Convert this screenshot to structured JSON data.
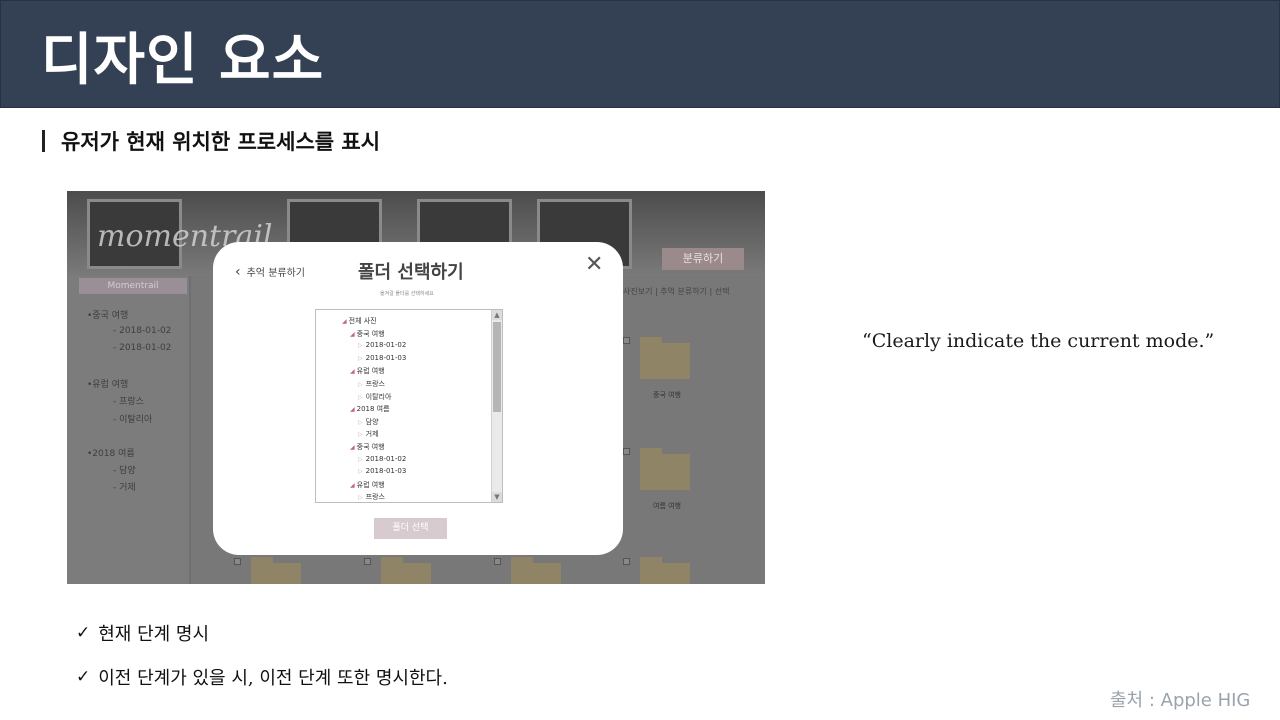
{
  "title": "디자인 요소",
  "subtitle": "유저가 현재 위치한 프로세스를 표시",
  "screenshot": {
    "logo": "momentrail",
    "sort_button": "분류하기",
    "path_text": "사진보기 | 추억 분류하기 | 선택",
    "sidebar_tab": "Momentrail",
    "sidebar_items": [
      "•중국 여행",
      "- 2018-01-02",
      "- 2018-01-02",
      "•유럽 여행",
      "- 프랑스",
      "- 이탈리아",
      "•2018 여름",
      "- 담양",
      "- 거제"
    ],
    "folder_labels": [
      "중국 여행",
      "여름 여행"
    ],
    "modal": {
      "back_label": "추억 분류하기",
      "title": "폴더 선택하기",
      "subtitle": "옮겨갈 폴더를 선택하세요",
      "close_symbol": "✕",
      "tree": [
        {
          "label": "전체 사진",
          "type": "caret"
        },
        {
          "label": "중국 여행",
          "type": "caret"
        },
        {
          "label": "2018-01-02",
          "type": "leaf"
        },
        {
          "label": "2018-01-03",
          "type": "leaf"
        },
        {
          "label": "유럽 여행",
          "type": "caret"
        },
        {
          "label": "프랑스",
          "type": "leaf"
        },
        {
          "label": "이탈리아",
          "type": "leaf"
        },
        {
          "label": "2018 여름",
          "type": "caret"
        },
        {
          "label": "담양",
          "type": "leaf"
        },
        {
          "label": "거제",
          "type": "leaf"
        },
        {
          "label": "중국 여행",
          "type": "caret"
        },
        {
          "label": "2018-01-02",
          "type": "leaf"
        },
        {
          "label": "2018-01-03",
          "type": "leaf"
        },
        {
          "label": "유럽 여행",
          "type": "caret"
        },
        {
          "label": "프랑스",
          "type": "leaf"
        }
      ],
      "select_button": "폴더 선택"
    }
  },
  "quote": "“Clearly indicate the current mode.”",
  "checklist": [
    "현재 단계 명시",
    "이전 단계가 있을 시, 이전 단계 또한 명시한다."
  ],
  "check_symbol": "✓",
  "source": "출처 : Apple HIG",
  "colors": {
    "header_bg": "#344054",
    "source_text": "#9aa3ad",
    "tree_caret": "#c9617e"
  }
}
